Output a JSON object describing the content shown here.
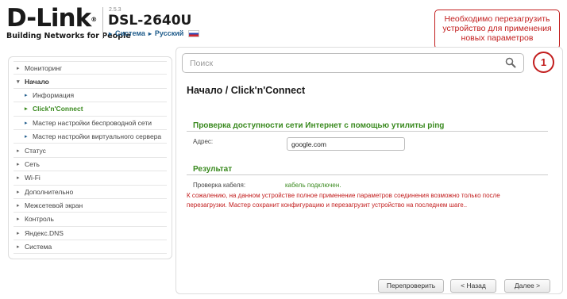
{
  "header": {
    "logo": "D-Link",
    "logo_mark": "®",
    "tagline": "Building Networks for People",
    "firmware": "2.5.3",
    "model": "DSL-2640U",
    "link_system": "Система",
    "link_language": "Русский"
  },
  "notice": "Необходимо перезагрузить устройство для применения новых параметров",
  "sidebar": {
    "items": [
      {
        "label": "Мониторинг",
        "arrow": "▸"
      },
      {
        "label": "Начало",
        "arrow": "▾"
      },
      {
        "label": "Информация",
        "arrow": "▸"
      },
      {
        "label": "Click'n'Connect",
        "arrow": "▸"
      },
      {
        "label": "Мастер настройки беспроводной сети",
        "arrow": "▸"
      },
      {
        "label": "Мастер настройки виртуального сервера",
        "arrow": "▸"
      },
      {
        "label": "Статус",
        "arrow": "▸"
      },
      {
        "label": "Сеть",
        "arrow": "▸"
      },
      {
        "label": "Wi-Fi",
        "arrow": "▸"
      },
      {
        "label": "Дополнительно",
        "arrow": "▸"
      },
      {
        "label": "Межсетевой экран",
        "arrow": "▸"
      },
      {
        "label": "Контроль",
        "arrow": "▸"
      },
      {
        "label": "Яндекс.DNS",
        "arrow": "▸"
      },
      {
        "label": "Система",
        "arrow": "▸"
      }
    ]
  },
  "search": {
    "placeholder": "Поиск"
  },
  "notification_count": "1",
  "page": {
    "title_part1": "Начало /",
    "title_part2": "Click'n'Connect",
    "ping_section_title": "Проверка доступности сети Интернет с помощью утилиты ping",
    "address_label": "Адрес:",
    "address_value": "google.com",
    "result_section_title": "Результат",
    "cable_check_label": "Проверка кабеля:",
    "cable_check_value": "кабель подключен.",
    "warning": "К сожалению, на данном устройстве полное применение параметров соединения возможно только после перезагрузки. Мастер сохранит конфигурацию и перезагрузит устройство на последнем шаге.."
  },
  "buttons": {
    "recheck": "Перепроверить",
    "back": "< Назад",
    "next": "Далее >"
  },
  "colors": {
    "accent_green": "#3a8a1f",
    "alert_red": "#c21d1d",
    "link_blue": "#1f5c8b"
  }
}
